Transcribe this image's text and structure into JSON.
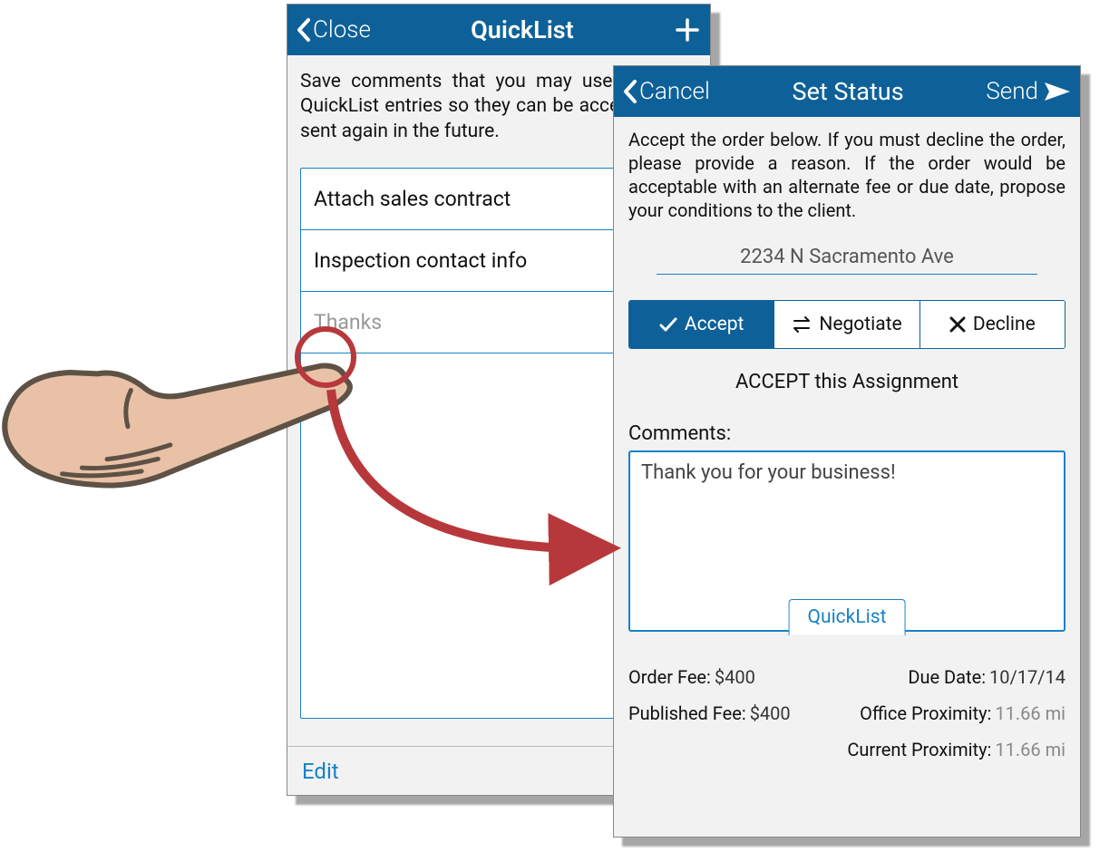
{
  "colors": {
    "brand": "#0e6198",
    "accent": "#1782c5",
    "annot": "#b7383b"
  },
  "quicklist": {
    "close_label": "Close",
    "title": "QuickList",
    "description": "Save comments that you may use often as QuickList entries so they can be accessed and sent again in the future.",
    "items": [
      {
        "label": "Attach sales contract"
      },
      {
        "label": "Inspection contact info"
      },
      {
        "label": "Thanks"
      }
    ],
    "edit_label": "Edit"
  },
  "set_status": {
    "cancel_label": "Cancel",
    "title": "Set Status",
    "send_label": "Send",
    "description": "Accept the order below. If you must decline the order, please provide a reason. If the order would be acceptable with an alternate fee or due date, propose your conditions to the client.",
    "address": "2234 N Sacramento Ave",
    "buttons": {
      "accept": "Accept",
      "negotiate": "Negotiate",
      "decline": "Decline"
    },
    "accept_line": "ACCEPT this Assignment",
    "comments_label": "Comments:",
    "comments_value": "Thank you for your business!",
    "quicklist_tab": "QuickList",
    "info": {
      "order_fee_label": "Order Fee:",
      "order_fee_value": "$400",
      "due_date_label": "Due Date:",
      "due_date_value": "10/17/14",
      "published_fee_label": "Published Fee:",
      "published_fee_value": "$400",
      "office_prox_label": "Office Proximity:",
      "office_prox_value": "11.66 mi",
      "current_prox_label": "Current Proximity:",
      "current_prox_value": "11.66 mi"
    }
  }
}
